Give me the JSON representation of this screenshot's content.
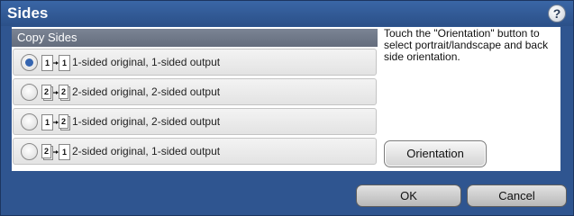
{
  "dialog": {
    "title": "Sides",
    "help_icon": "?",
    "list_header": "Copy Sides",
    "help_text": "Touch the \"Orientation\" button to select portrait/landscape and back side orientation.",
    "orientation_label": "Orientation",
    "ok_label": "OK",
    "cancel_label": "Cancel"
  },
  "options": [
    {
      "icon": "1-to-1-sided-icon",
      "from": "1",
      "to": "1",
      "label": "1-sided original, 1-sided output",
      "selected": true
    },
    {
      "icon": "2-to-2-sided-icon",
      "from": "2",
      "to": "2",
      "label": "2-sided original, 2-sided output",
      "selected": false
    },
    {
      "icon": "1-to-2-sided-icon",
      "from": "1",
      "to": "2",
      "label": "1-sided original, 2-sided output",
      "selected": false
    },
    {
      "icon": "2-to-1-sided-icon",
      "from": "2",
      "to": "1",
      "label": "2-sided original, 1-sided output",
      "selected": false
    }
  ],
  "colors": {
    "title_bar": "#2f5590",
    "header": "#6e7787",
    "selected_radio": "#3565b0"
  }
}
